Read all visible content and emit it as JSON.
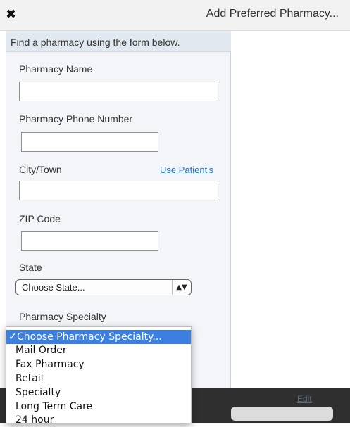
{
  "header": {
    "close_icon": "close-icon",
    "title": "Add Preferred Pharmacy..."
  },
  "form": {
    "instructions": "Find a pharmacy using the form below.",
    "pharmacy_name_label": "Pharmacy Name",
    "pharmacy_name_value": "",
    "phone_label": "Pharmacy Phone Number",
    "phone_value": "",
    "city_label": "City/Town",
    "use_patient_link": "Use Patient's",
    "city_value": "",
    "zip_label": "ZIP Code",
    "zip_value": "",
    "state_label": "State",
    "state_selected": "Choose State...",
    "specialty_label": "Pharmacy Specialty"
  },
  "background": {
    "edit_link": "Edit"
  },
  "specialty_dropdown": {
    "checkmark": "✓",
    "selected_index": 0,
    "options": [
      "Choose Pharmacy Specialty...",
      "Mail Order",
      "Fax Pharmacy",
      "Retail",
      "Specialty",
      "Long Term Care",
      "24 hour"
    ]
  }
}
